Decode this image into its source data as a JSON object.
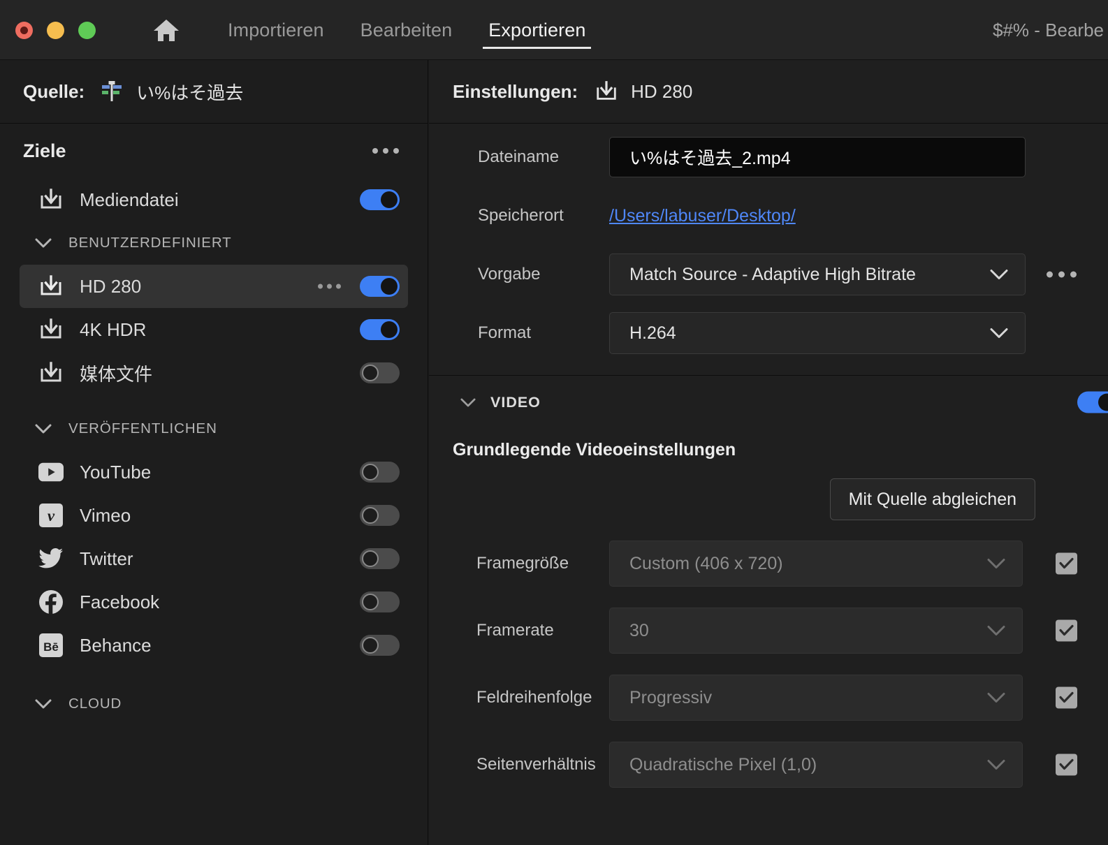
{
  "window": {
    "title": "$#% - Bearbe",
    "traffic_lights": [
      "close-red",
      "minimize-yellow",
      "maximize-green"
    ]
  },
  "nav": {
    "home_icon": "home-icon",
    "tabs": [
      {
        "label": "Importieren",
        "active": false
      },
      {
        "label": "Bearbeiten",
        "active": false
      },
      {
        "label": "Exportieren",
        "active": true
      }
    ]
  },
  "source": {
    "label": "Quelle:",
    "icon": "sequence-icon",
    "name": "い%はそ過去"
  },
  "destinations": {
    "title": "Ziele",
    "more_icon": "more-options-icon",
    "media_file": {
      "icon": "download-icon",
      "label": "Mediendatei",
      "toggle": "on"
    },
    "groups": [
      {
        "name": "BENUTZERDEFINIERT",
        "expanded": true,
        "items": [
          {
            "icon": "download-icon",
            "label": "HD 280",
            "toggle": "on",
            "selected": true,
            "has_kebab": true
          },
          {
            "icon": "download-icon",
            "label": "4K HDR",
            "toggle": "on",
            "selected": false,
            "has_kebab": false
          },
          {
            "icon": "download-icon",
            "label": "媒体文件",
            "toggle": "off",
            "selected": false,
            "has_kebab": false
          }
        ]
      },
      {
        "name": "VERÖFFENTLICHEN",
        "expanded": true,
        "items": [
          {
            "icon": "youtube-icon",
            "label": "YouTube",
            "toggle": "off",
            "selected": false,
            "has_kebab": false
          },
          {
            "icon": "vimeo-icon",
            "label": "Vimeo",
            "toggle": "off",
            "selected": false,
            "has_kebab": false
          },
          {
            "icon": "twitter-icon",
            "label": "Twitter",
            "toggle": "off",
            "selected": false,
            "has_kebab": false
          },
          {
            "icon": "facebook-icon",
            "label": "Facebook",
            "toggle": "off",
            "selected": false,
            "has_kebab": false
          },
          {
            "icon": "behance-icon",
            "label": "Behance",
            "toggle": "off",
            "selected": false,
            "has_kebab": false
          }
        ]
      },
      {
        "name": "CLOUD",
        "expanded": true,
        "items": []
      }
    ]
  },
  "settings": {
    "label": "Einstellungen:",
    "icon": "download-icon",
    "value": "HD 280",
    "fields": {
      "filename": {
        "label": "Dateiname",
        "value": "い%はそ過去_2.mp4",
        "placeholder": "Dateiname"
      },
      "location": {
        "label": "Speicherort",
        "value": "/Users/labuser/Desktop/"
      },
      "preset": {
        "label": "Vorgabe",
        "value": "Match Source - Adaptive High Bitrate",
        "more_icon": "more-options-icon"
      },
      "format": {
        "label": "Format",
        "value": "H.264"
      }
    }
  },
  "video_section": {
    "title": "VIDEO",
    "expanded": true,
    "toggle": "on",
    "subheading": "Grundlegende Videoeinstellungen",
    "match_source_button": "Mit Quelle abgleichen",
    "rows": [
      {
        "label": "Framegröße",
        "value": "Custom (406 x 720)",
        "checked": true,
        "disabled": true
      },
      {
        "label": "Framerate",
        "value": "30",
        "checked": true,
        "disabled": true
      },
      {
        "label": "Feldreihenfolge",
        "value": "Progressiv",
        "checked": true,
        "disabled": true
      },
      {
        "label": "Seitenverhältnis",
        "value": "Quadratische Pixel (1,0)",
        "checked": true,
        "disabled": true
      }
    ]
  },
  "colors": {
    "accent_blue": "#3D7FF4",
    "link_blue": "#4F87F8",
    "panel_bg": "#1F1F1F",
    "sidebar_bg": "#1D1D1D",
    "titlebar_bg": "#252525",
    "selected_row": "#333333",
    "checkbox": "#A9A9A9"
  }
}
